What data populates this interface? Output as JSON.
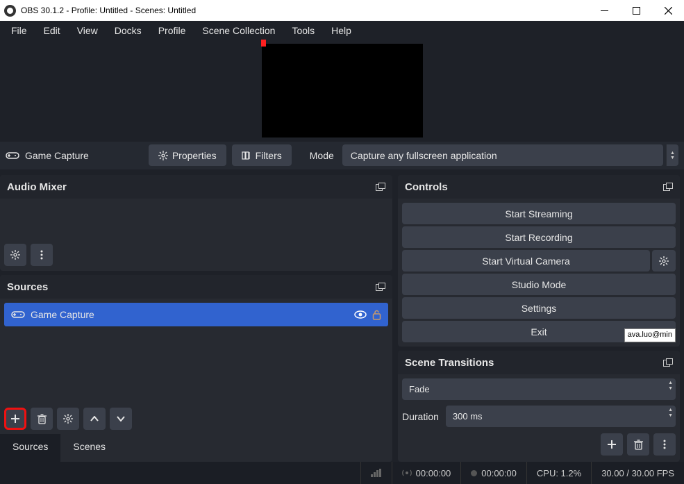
{
  "titlebar": {
    "text": "OBS 30.1.2 - Profile: Untitled - Scenes: Untitled"
  },
  "menu": [
    "File",
    "Edit",
    "View",
    "Docks",
    "Profile",
    "Scene Collection",
    "Tools",
    "Help"
  ],
  "source_toolbar": {
    "source_name": "Game Capture",
    "properties_btn": "Properties",
    "filters_btn": "Filters",
    "mode_label": "Mode",
    "mode_value": "Capture any fullscreen application"
  },
  "panels": {
    "audio_mixer": "Audio Mixer",
    "sources": "Sources",
    "controls": "Controls",
    "transitions": "Scene Transitions"
  },
  "source_item": {
    "label": "Game Capture"
  },
  "tabs": {
    "sources": "Sources",
    "scenes": "Scenes"
  },
  "controls": {
    "start_streaming": "Start Streaming",
    "start_recording": "Start Recording",
    "start_virtual": "Start Virtual Camera",
    "studio_mode": "Studio Mode",
    "settings": "Settings",
    "exit": "Exit"
  },
  "transitions": {
    "selected": "Fade",
    "duration_label": "Duration",
    "duration_value": "300 ms"
  },
  "status": {
    "live_time": "00:00:00",
    "rec_time": "00:00:00",
    "cpu": "CPU: 1.2%",
    "fps": "30.00 / 30.00 FPS"
  },
  "overlay": {
    "email": "ava.luo@min"
  }
}
